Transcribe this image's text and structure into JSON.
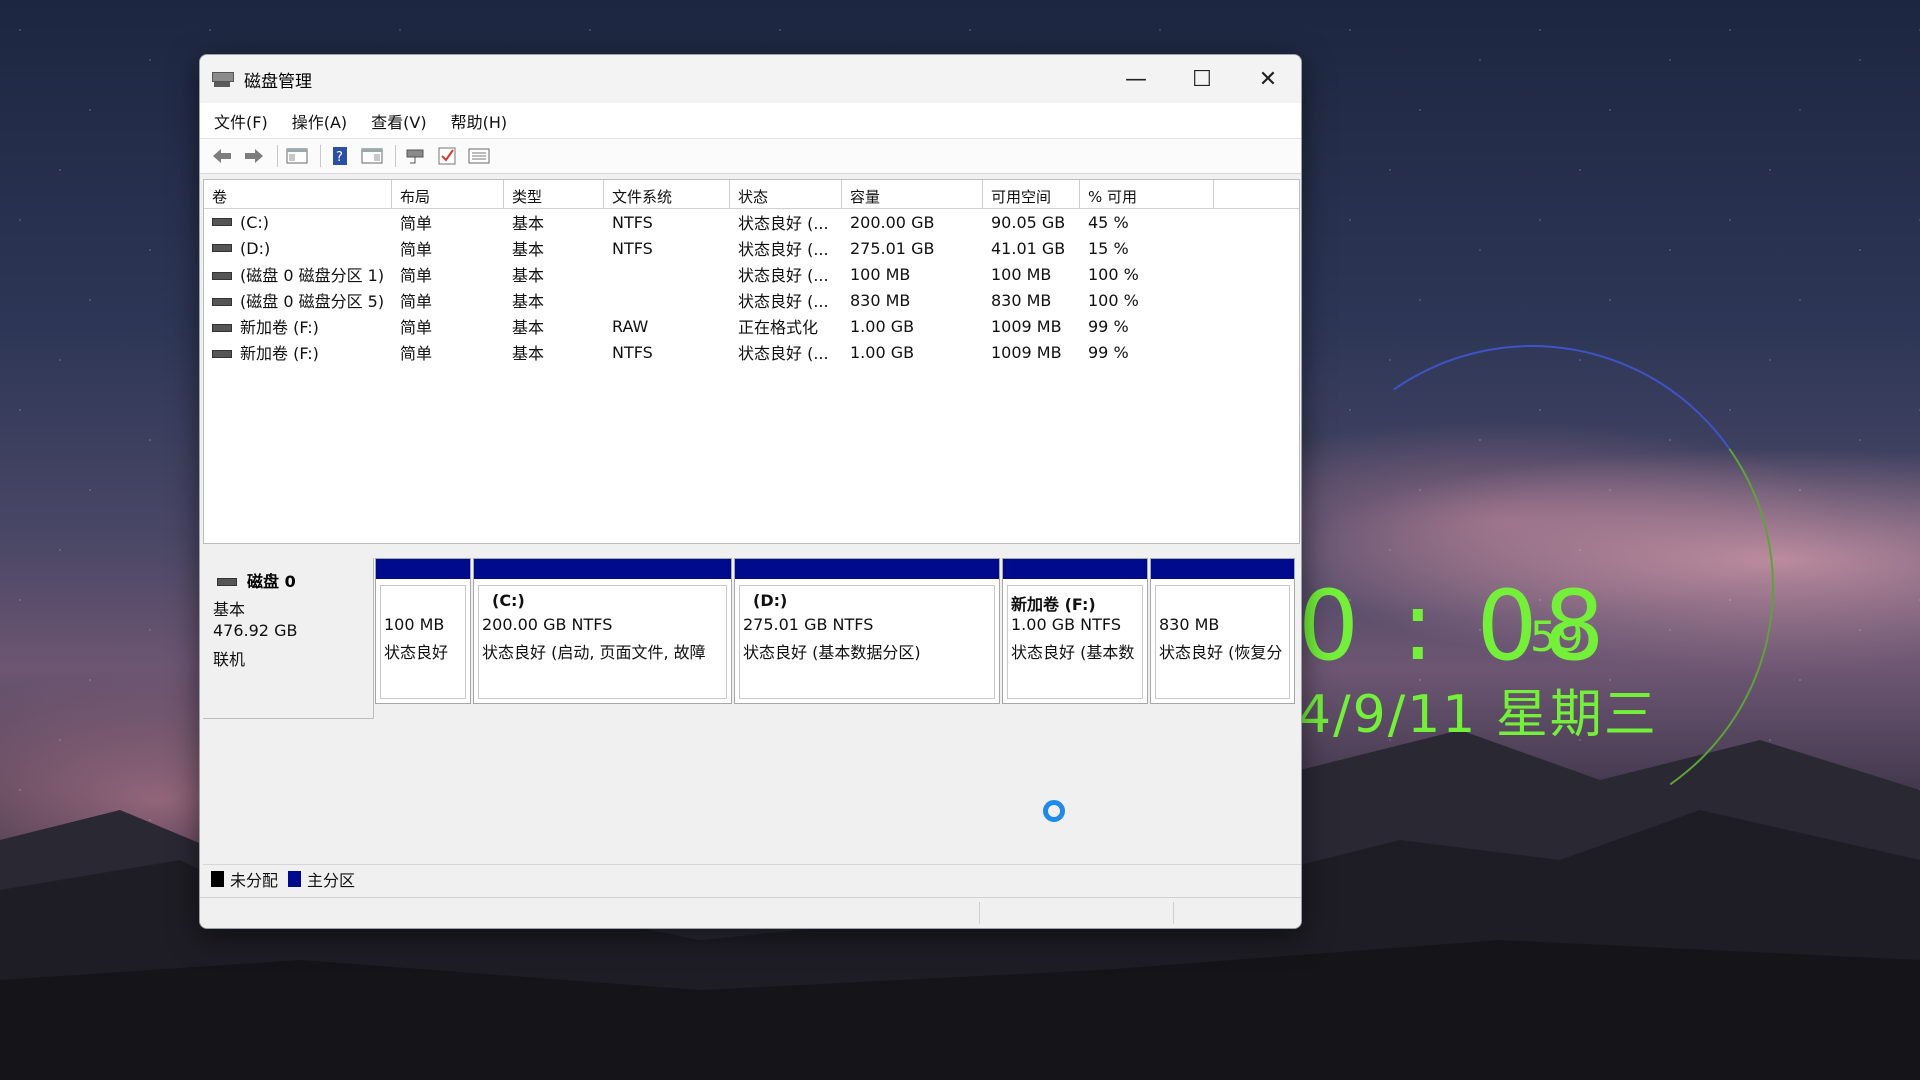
{
  "window": {
    "title": "磁盘管理",
    "minimize": "—",
    "maximize": "☐",
    "close": "✕"
  },
  "menu": [
    "文件(F)",
    "操作(A)",
    "查看(V)",
    "帮助(H)"
  ],
  "toolbar": [
    "back-icon",
    "forward-icon",
    "console-tree-icon",
    "help-icon",
    "properties-icon",
    "connect-icon",
    "check-icon",
    "list-icon"
  ],
  "columns": [
    "卷",
    "布局",
    "类型",
    "文件系统",
    "状态",
    "容量",
    "可用空间",
    "% 可用"
  ],
  "rows": [
    [
      "(C:)",
      "简单",
      "基本",
      "NTFS",
      "状态良好 (...",
      "200.00 GB",
      "90.05 GB",
      "45 %"
    ],
    [
      "(D:)",
      "简单",
      "基本",
      "NTFS",
      "状态良好 (...",
      "275.01 GB",
      "41.01 GB",
      "15 %"
    ],
    [
      "(磁盘 0 磁盘分区 1)",
      "简单",
      "基本",
      "",
      "状态良好 (...",
      "100 MB",
      "100 MB",
      "100 %"
    ],
    [
      "(磁盘 0 磁盘分区 5)",
      "简单",
      "基本",
      "",
      "状态良好 (...",
      "830 MB",
      "830 MB",
      "100 %"
    ],
    [
      "新加卷 (F:)",
      "简单",
      "基本",
      "RAW",
      "正在格式化",
      "1.00 GB",
      "1009 MB",
      "99 %"
    ],
    [
      "新加卷 (F:)",
      "简单",
      "基本",
      "NTFS",
      "状态良好 (...",
      "1.00 GB",
      "1009 MB",
      "99 %"
    ]
  ],
  "disk": {
    "name": "磁盘 0",
    "type": "基本",
    "size": "476.92 GB",
    "state": "联机",
    "partitions": [
      {
        "title": "",
        "line1": "100 MB",
        "line2": "状态良好"
      },
      {
        "title": "(C:)",
        "line1": "200.00 GB NTFS",
        "line2": "状态良好 (启动, 页面文件, 故障"
      },
      {
        "title": "(D:)",
        "line1": "275.01 GB NTFS",
        "line2": "状态良好 (基本数据分区)"
      },
      {
        "title": "新加卷  (F:)",
        "line1": "1.00 GB NTFS",
        "line2": "状态良好 (基本数"
      },
      {
        "title": "",
        "line1": "830 MB",
        "line2": "状态良好 (恢复分"
      }
    ]
  },
  "legend": [
    {
      "label": "未分配",
      "color": "#000000"
    },
    {
      "label": "主分区",
      "color": "#000a8c"
    }
  ],
  "desktop_clock": {
    "time": "0 : 08",
    "seconds": "59",
    "date": "4/9/11 星期三",
    "color": "#74f03a"
  }
}
